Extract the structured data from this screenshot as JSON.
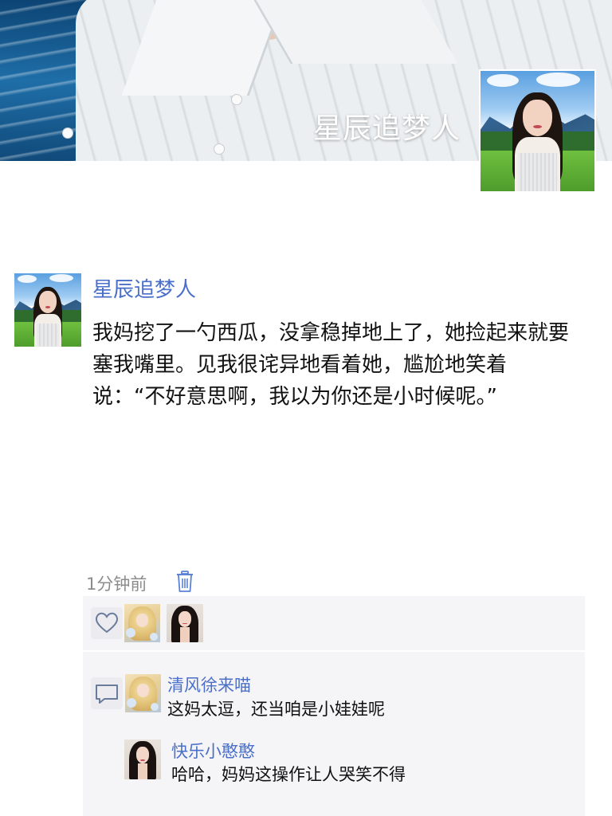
{
  "profile": {
    "cover_name": "星辰追梦人"
  },
  "post": {
    "author": "星辰追梦人",
    "text": "我妈挖了一勺西瓜，没拿稳掉地上了，她捡起来就要塞我嘴里。见我很诧异地看着她，尴尬地笑着说：“不好意思啊，我以为你还是小时候呢。”",
    "time": "1分钟前"
  },
  "likes": {
    "icon": "heart-icon",
    "avatars": [
      "blonde-girl-avatar",
      "dark-hair-woman-avatar"
    ]
  },
  "comments": [
    {
      "author": "清风徐来喵",
      "text": "这妈太逗，还当咱是小娃娃呢"
    },
    {
      "author": "快乐小憨憨",
      "text": "哈哈，妈妈这操作让人哭笑不得"
    }
  ],
  "colors": {
    "link_blue": "#4a6fc9",
    "time_gray": "#8c8c8c",
    "panel_bg": "#f5f5f7"
  }
}
